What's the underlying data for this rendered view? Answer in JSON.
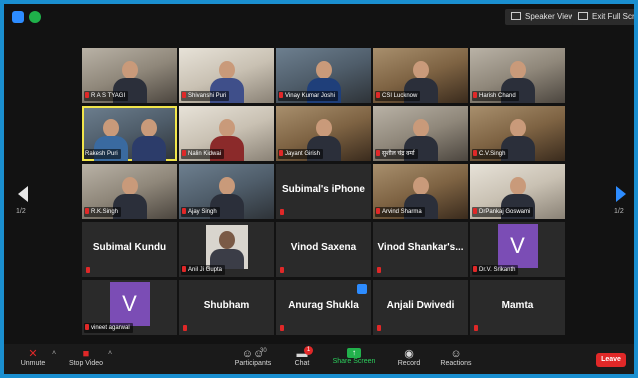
{
  "topbar": {
    "speaker_view_label": "Speaker View",
    "exit_fullscreen_label": "Exit Full Screen"
  },
  "pagination": {
    "left": "1/2",
    "right": "1/2"
  },
  "tiles": [
    {
      "name": "R A S TYAGI",
      "kind": "video"
    },
    {
      "name": "Shivanshi Puri",
      "kind": "video"
    },
    {
      "name": "Vinay Kumar Joshi",
      "kind": "video"
    },
    {
      "name": "CSI Lucknow",
      "kind": "video"
    },
    {
      "name": "Harish Chand",
      "kind": "video"
    },
    {
      "name": "Rakesh Puri",
      "kind": "video"
    },
    {
      "name": "Nalin Kidwai",
      "kind": "video"
    },
    {
      "name": "Jayant Girish",
      "kind": "video"
    },
    {
      "name": "सुशील चंद्र वर्मा",
      "kind": "video"
    },
    {
      "name": "C.V.Singh",
      "kind": "video"
    },
    {
      "name": "R.K.Singh",
      "kind": "video"
    },
    {
      "name": "Ajay Singh",
      "kind": "video"
    },
    {
      "name": "Subimal's iPhone",
      "kind": "name"
    },
    {
      "name": "Arvind Sharma",
      "kind": "video"
    },
    {
      "name": "DrPankaj Goswami",
      "kind": "video"
    },
    {
      "name": "Subimal Kundu",
      "kind": "name"
    },
    {
      "name": "Anil Ji Gupta",
      "kind": "photo"
    },
    {
      "name": "Vinod Saxena",
      "kind": "name"
    },
    {
      "name": "Vinod Shankar's...",
      "kind": "name"
    },
    {
      "name": "Dr.V. Srikanth",
      "kind": "avatar",
      "initial": "V"
    },
    {
      "name": "vineet agarwal",
      "kind": "avatar",
      "initial": "V"
    },
    {
      "name": "Shubham",
      "kind": "name"
    },
    {
      "name": "Anurag Shukla",
      "kind": "name"
    },
    {
      "name": "Anjali Dwivedi",
      "kind": "name"
    },
    {
      "name": "Mamta",
      "kind": "name"
    }
  ],
  "toolbar": {
    "unmute": "Unmute",
    "stop_video": "Stop Video",
    "participants": "Participants",
    "participants_count": "30",
    "chat": "Chat",
    "chat_badge": "1",
    "share_screen": "Share Screen",
    "record": "Record",
    "reactions": "Reactions",
    "leave": "Leave"
  },
  "colors": {
    "accent": "#2d8cff",
    "leave": "#e02828",
    "share": "#22b14c",
    "active_speaker": "#f1e54b",
    "avatar": "#7b4db5"
  }
}
